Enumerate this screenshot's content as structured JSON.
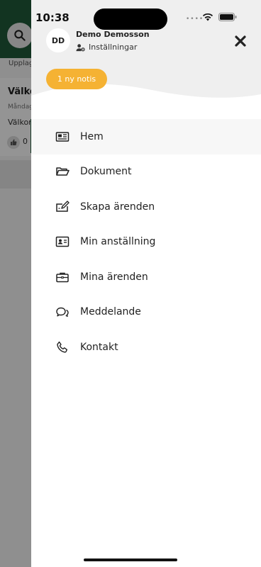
{
  "status_bar": {
    "time": "10:38"
  },
  "background_app": {
    "subtext": "Upplagt",
    "card_title": "Välko",
    "card_meta": "Måndag",
    "card_text": "Välkon",
    "like_count": "0"
  },
  "drawer": {
    "avatar_initials": "DD",
    "user_name": "Demo Demosson",
    "settings_label": "Inställningar",
    "notification_badge": "1 ny notis",
    "menu": [
      {
        "label": "Hem",
        "icon": "newspaper-icon"
      },
      {
        "label": "Dokument",
        "icon": "folder-open-icon"
      },
      {
        "label": "Skapa ärenden",
        "icon": "edit-form-icon"
      },
      {
        "label": "Min anställning",
        "icon": "id-card-icon"
      },
      {
        "label": "Mina ärenden",
        "icon": "briefcase-icon"
      },
      {
        "label": "Meddelande",
        "icon": "chat-bubbles-icon"
      },
      {
        "label": "Kontakt",
        "icon": "phone-icon"
      }
    ]
  },
  "colors": {
    "brand_green": "#1f5a3a",
    "notis_orange": "#f5b233",
    "header_gray": "#efefef"
  }
}
